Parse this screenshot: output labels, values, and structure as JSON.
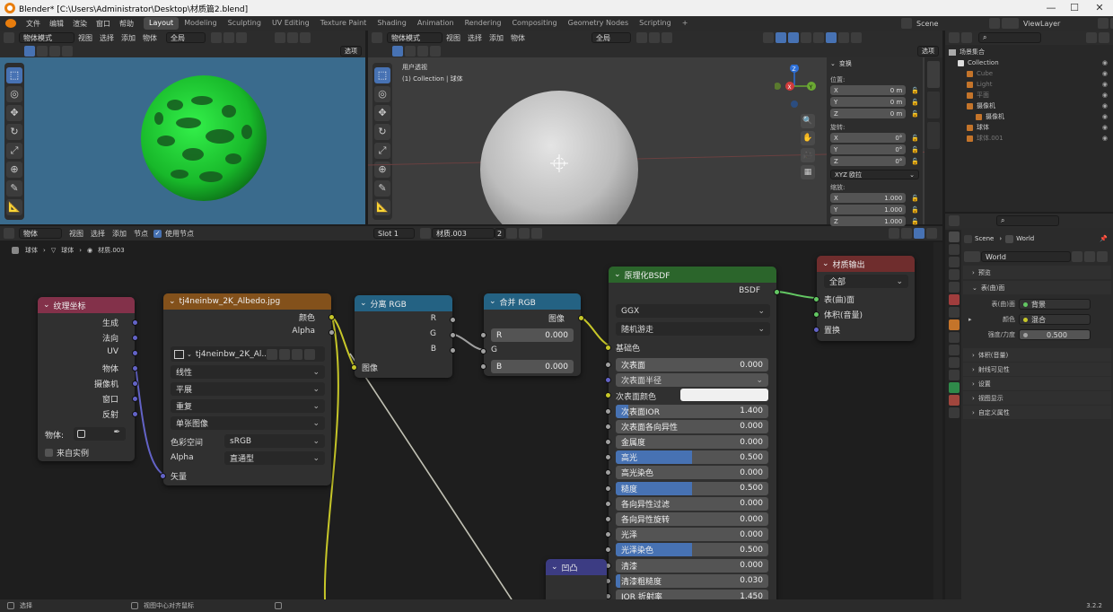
{
  "window": {
    "title": "Blender* [C:\\Users\\Administrator\\Desktop\\材质篇2.blend]",
    "controls": [
      "—",
      "☐",
      "✕"
    ]
  },
  "menu": [
    "文件",
    "编辑",
    "渲染",
    "窗口",
    "帮助"
  ],
  "workspaces": [
    {
      "label": "Layout",
      "active": true
    },
    {
      "label": "Modeling"
    },
    {
      "label": "Sculpting"
    },
    {
      "label": "UV Editing"
    },
    {
      "label": "Texture Paint"
    },
    {
      "label": "Shading"
    },
    {
      "label": "Animation"
    },
    {
      "label": "Rendering"
    },
    {
      "label": "Compositing"
    },
    {
      "label": "Geometry Nodes"
    },
    {
      "label": "Scripting"
    },
    {
      "label": "+"
    }
  ],
  "scene_name": "Scene",
  "view_layer": "ViewLayer",
  "left_viewport": {
    "mode": "物体模式",
    "menus": [
      "视图",
      "选择",
      "添加",
      "物体"
    ],
    "orientation": "全局",
    "options_label": "选项"
  },
  "main_viewport": {
    "mode": "物体模式",
    "menus": [
      "视图",
      "选择",
      "添加",
      "物体"
    ],
    "orientation": "全局",
    "overlay_title": "用户透视",
    "overlay_subtitle": "(1) Collection | 球体",
    "options_label": "选项"
  },
  "transform_panel": {
    "title": "变换",
    "location_label": "位置:",
    "location": [
      {
        "axis": "X",
        "value": "0 m"
      },
      {
        "axis": "Y",
        "value": "0 m"
      },
      {
        "axis": "Z",
        "value": "0 m"
      }
    ],
    "rotation_label": "旋转:",
    "rotation": [
      {
        "axis": "X",
        "value": "0°"
      },
      {
        "axis": "Y",
        "value": "0°"
      },
      {
        "axis": "Z",
        "value": "0°"
      }
    ],
    "rotation_mode": "XYZ 欧拉",
    "scale_label": "缩放:",
    "scale": [
      {
        "axis": "X",
        "value": "1.000"
      },
      {
        "axis": "Y",
        "value": "1.000"
      },
      {
        "axis": "Z",
        "value": "1.000"
      }
    ]
  },
  "outliner": {
    "root": "场景集合",
    "items": [
      {
        "label": "Collection",
        "depth": 1,
        "color": "#ccc"
      },
      {
        "label": "Cube",
        "depth": 2,
        "color": "#777"
      },
      {
        "label": "Light",
        "depth": 2,
        "color": "#777"
      },
      {
        "label": "平面",
        "depth": 2,
        "color": "#777"
      },
      {
        "label": "摄像机",
        "depth": 2,
        "color": "#ccc"
      },
      {
        "label": "摄像机",
        "depth": 3,
        "color": "#ccc"
      },
      {
        "label": "球体",
        "depth": 2,
        "color": "#ccc"
      },
      {
        "label": "球体.001",
        "depth": 2,
        "color": "#777"
      }
    ]
  },
  "node_editor": {
    "object_mode": "物体",
    "menus": [
      "视图",
      "选择",
      "添加",
      "节点"
    ],
    "use_nodes_label": "使用节点",
    "slot": "Slot 1",
    "material": "材质.003",
    "users": "2",
    "breadcrumb": [
      "球体",
      "球体",
      "材质.003"
    ]
  },
  "nodes": {
    "texcoord": {
      "title": "纹理坐标",
      "outputs": [
        "生成",
        "法向",
        "UV",
        "物体",
        "摄像机",
        "窗口",
        "反射"
      ],
      "object_label": "物体:",
      "from_instancer": "来自实例"
    },
    "image": {
      "title": "tj4neinbw_2K_Albedo.jpg",
      "outputs": [
        "颜色",
        "Alpha"
      ],
      "image_name": "tj4neinbw_2K_Al...",
      "interpolation": "线性",
      "projection": "平展",
      "extension": "重复",
      "source": "单张图像",
      "colorspace_label": "色彩空间",
      "colorspace": "sRGB",
      "alpha_label": "Alpha",
      "alpha_mode": "直通型",
      "input": "矢量"
    },
    "separate": {
      "title": "分离 RGB",
      "outputs": [
        "R",
        "G",
        "B"
      ],
      "input": "图像"
    },
    "combine": {
      "title": "合并 RGB",
      "output": "图像",
      "r_label": "R",
      "r_value": "0.000",
      "g_label": "G",
      "b_label": "B",
      "b_value": "0.000"
    },
    "bsdf": {
      "title": "原理化BSDF",
      "output": "BSDF",
      "distribution": "GGX",
      "subsurface_method": "随机游走",
      "base_color": "基础色",
      "fields": [
        {
          "label": "次表面",
          "value": "0.000",
          "fill": 0
        },
        {
          "label": "次表面半径",
          "value": "",
          "fill": 0,
          "dropdown": true
        },
        {
          "label": "次表面颜色",
          "value": "",
          "fill": 0,
          "color": "#f0f0f0"
        },
        {
          "label": "次表面IOR",
          "value": "1.400",
          "fill": 0.08
        },
        {
          "label": "次表面各向异性",
          "value": "0.000",
          "fill": 0
        },
        {
          "label": "金属度",
          "value": "0.000",
          "fill": 0
        },
        {
          "label": "高光",
          "value": "0.500",
          "fill": 0.5
        },
        {
          "label": "高光染色",
          "value": "0.000",
          "fill": 0
        },
        {
          "label": "糙度",
          "value": "0.500",
          "fill": 0.5
        },
        {
          "label": "各向异性过滤",
          "value": "0.000",
          "fill": 0
        },
        {
          "label": "各向异性旋转",
          "value": "0.000",
          "fill": 0
        },
        {
          "label": "光泽",
          "value": "0.000",
          "fill": 0
        },
        {
          "label": "光泽染色",
          "value": "0.500",
          "fill": 0.5
        },
        {
          "label": "清漆",
          "value": "0.000",
          "fill": 0
        },
        {
          "label": "清漆粗糙度",
          "value": "0.030",
          "fill": 0.03
        },
        {
          "label": "IOR 折射率",
          "value": "1.450",
          "fill": 0
        }
      ]
    },
    "output": {
      "title": "材质输出",
      "target": "全部",
      "inputs": [
        "表(曲)面",
        "体积(音量)",
        "置换"
      ]
    },
    "bump": {
      "title": "凹凸"
    }
  },
  "properties": {
    "breadcrumb_scene": "Scene",
    "breadcrumb_world": "World",
    "world_name": "World",
    "sections": [
      {
        "label": "预览",
        "open": false
      },
      {
        "label": "表(曲)面",
        "open": true
      }
    ],
    "surface_label": "表(曲)面",
    "surface_value": "背景",
    "color_label": "颜色",
    "color_value": "混合",
    "strength_label": "强度/力度",
    "strength_value": "0.500",
    "more_sections": [
      "体积(音量)",
      "射线可见性",
      "设置",
      "视图显示",
      "自定义属性"
    ]
  },
  "status": {
    "left": "选择",
    "middle": "视图中心对齐鼠标",
    "version": "3.2.2"
  },
  "colors": {
    "accent": "#4772b3",
    "node_texcoord": "#83314a",
    "node_texture": "#83511b",
    "node_converter": "#246283",
    "node_shader": "#2b652b",
    "node_output": "#6f2d2d",
    "node_vector": "#3c3c83",
    "socket_color": "#c7c729",
    "socket_float": "#a1a1a1",
    "socket_vector": "#6363c7",
    "socket_shader": "#63c763",
    "link_color": "#c7c729"
  }
}
